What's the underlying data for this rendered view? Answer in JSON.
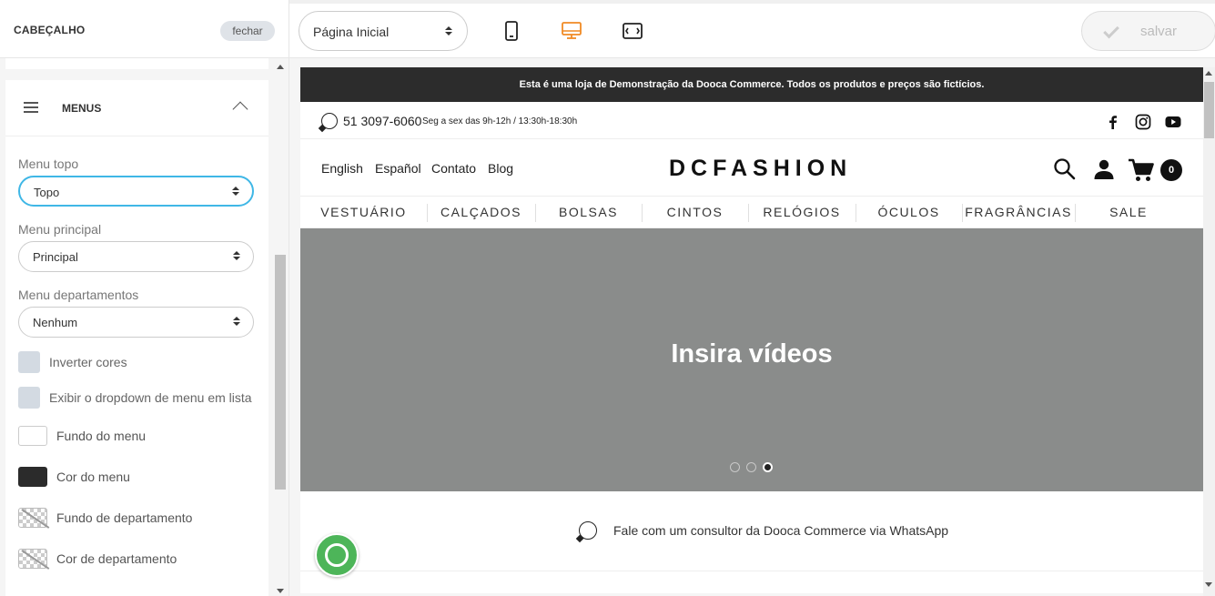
{
  "sidebar": {
    "title": "CABEÇALHO",
    "close_label": "fechar",
    "section_title": "MENUS",
    "menu_topo": {
      "label": "Menu topo",
      "value": "Topo"
    },
    "menu_principal": {
      "label": "Menu principal",
      "value": "Principal"
    },
    "menu_departamentos": {
      "label": "Menu departamentos",
      "value": "Nenhum"
    },
    "checkboxes": [
      {
        "label": "Inverter cores",
        "checked": false
      },
      {
        "label": "Exibir o dropdown de menu em lista",
        "checked": false
      }
    ],
    "colors": [
      {
        "label": "Fundo do menu",
        "value": "#ffffff"
      },
      {
        "label": "Cor do menu",
        "value": "#2b2b2b"
      },
      {
        "label": "Fundo de departamento",
        "value": "transparent"
      },
      {
        "label": "Cor de departamento",
        "value": "transparent"
      }
    ]
  },
  "toolbar": {
    "page_select": "Página Inicial",
    "devices": [
      {
        "icon": "mobile-icon",
        "active": false
      },
      {
        "icon": "desktop-icon",
        "active": true
      },
      {
        "icon": "fullscreen-icon",
        "active": false
      }
    ],
    "save_label": "salvar",
    "accent": "#f08a24"
  },
  "preview": {
    "announcement": "Esta é uma loja de Demonstração da Dooca Commerce. Todos os produtos e preços são fictícios.",
    "phone": "51 3097-6060",
    "hours": "Seg a sex das 9h-12h / 13:30h-18:30h",
    "social_icons": [
      "facebook-icon",
      "instagram-icon",
      "youtube-icon"
    ],
    "top_links": [
      "English",
      "Español",
      "Contato",
      "Blog"
    ],
    "logo": "DCFASHION",
    "cart_count": "0",
    "nav": [
      "VESTUÁRIO",
      "CALÇADOS",
      "BOLSAS",
      "CINTOS",
      "RELÓGIOS",
      "ÓCULOS",
      "FRAGRÂNCIAS",
      "SALE"
    ],
    "hero_text": "Insira vídeos",
    "slides_total": 3,
    "slide_active": 3,
    "whatsapp_text": "Fale com um consultor da Dooca Commerce via WhatsApp"
  }
}
